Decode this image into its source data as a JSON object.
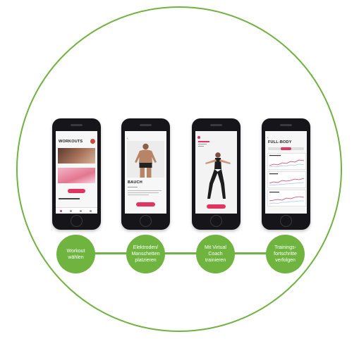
{
  "colors": {
    "accent": "#6fb43f",
    "pink": "#e3345f"
  },
  "phones": [
    {
      "title": "WORKOUTS",
      "subtitle": "",
      "button": ""
    },
    {
      "title": "BAUCH",
      "subtitle": "",
      "button": ""
    },
    {
      "title": "",
      "subtitle": "",
      "button": ""
    },
    {
      "title": "FULL-BODY",
      "subtitle": "",
      "button": ""
    }
  ],
  "steps": [
    "Workout\nwählen",
    "Elektroden/\nManschetten\nplatzieren",
    "Mit Virtual\nCoach\ntrainieren",
    "Trainings-\nfortschritte\nverfolgen"
  ]
}
